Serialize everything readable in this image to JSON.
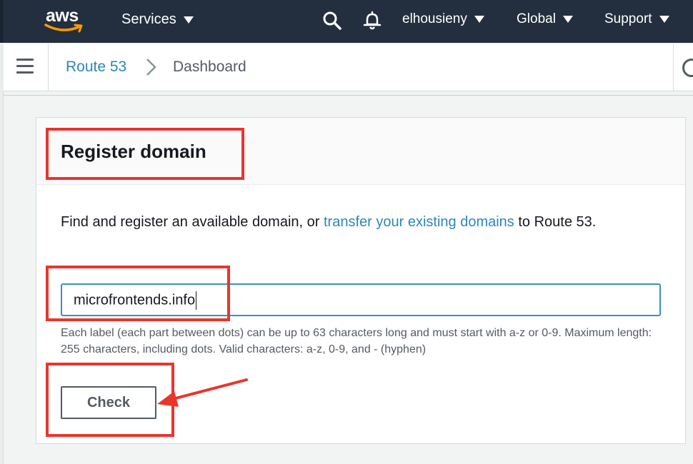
{
  "nav": {
    "logo_text": "aws",
    "services_label": "Services",
    "user_label": "elhousieny",
    "region_label": "Global",
    "support_label": "Support"
  },
  "breadcrumb": {
    "parent": "Route 53",
    "current": "Dashboard"
  },
  "panel": {
    "title": "Register domain",
    "desc_before": "Find and register an available domain, or ",
    "desc_link": "transfer your existing domains",
    "desc_after": " to Route 53.",
    "input_value": "microfrontends.info",
    "hint": "Each label (each part between dots) can be up to 63 characters long and must start with a-z or 0-9. Maximum length: 255 characters, including dots. Valid characters: a-z, 0-9, and - (hyphen)",
    "check_label": "Check"
  },
  "colors": {
    "nav_bg": "#232f3e",
    "link": "#2e86b9",
    "annotation_red": "#e8362d",
    "input_focus": "#3a8fc4"
  },
  "icons": [
    "aws-smile-icon",
    "caret-down-icon",
    "search-icon",
    "bell-icon",
    "hamburger-icon",
    "chevron-right-icon"
  ]
}
